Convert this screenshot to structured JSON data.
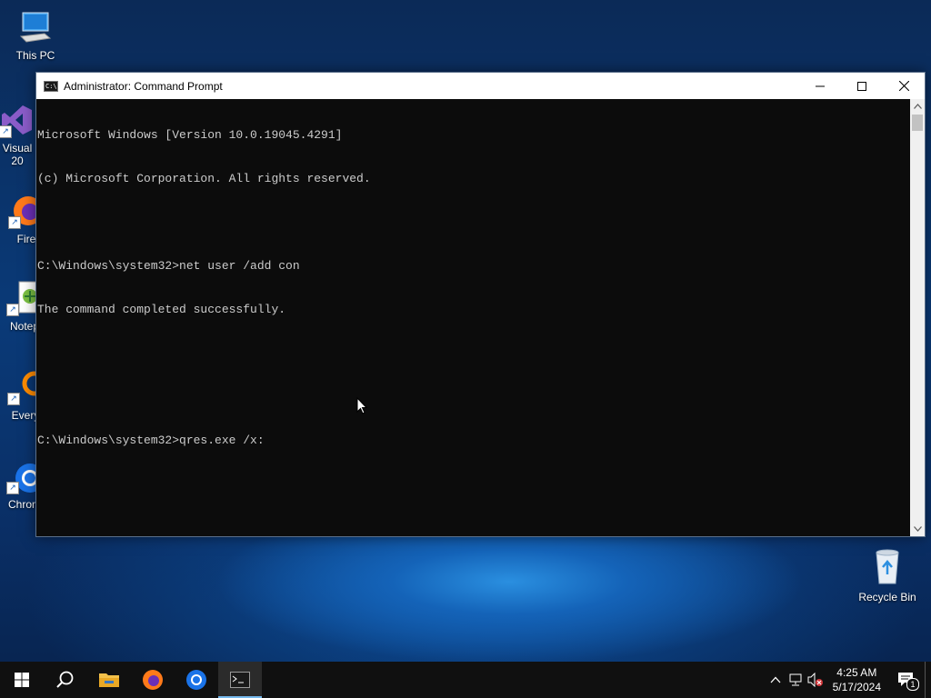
{
  "desktop": {
    "icons": [
      {
        "label": "This PC",
        "icon": "computer-icon"
      },
      {
        "label": "Visual\n20",
        "icon": "visual-studio-icon"
      },
      {
        "label": "Fire",
        "icon": "firefox-icon"
      },
      {
        "label": "Notep",
        "icon": "notepad-icon"
      },
      {
        "label": "Every",
        "icon": "everything-icon"
      },
      {
        "label": "Chrom",
        "icon": "chrome-icon"
      }
    ],
    "recycle_bin": {
      "label": "Recycle Bin",
      "icon": "recycle-bin-icon"
    }
  },
  "window": {
    "title": "Administrator: Command Prompt",
    "console_lines": [
      "Microsoft Windows [Version 10.0.19045.4291]",
      "(c) Microsoft Corporation. All rights reserved.",
      "",
      "C:\\Windows\\system32>net user /add con",
      "The command completed successfully.",
      "",
      "",
      "C:\\Windows\\system32>qres.exe /x:"
    ],
    "controls": {
      "minimize": "minimize-icon",
      "maximize": "maximize-icon",
      "close": "close-icon"
    }
  },
  "taskbar": {
    "buttons": [
      {
        "name": "start",
        "icon": "windows-logo-icon"
      },
      {
        "name": "search",
        "icon": "search-icon"
      },
      {
        "name": "file-explorer",
        "icon": "folder-icon"
      },
      {
        "name": "firefox",
        "icon": "firefox-icon"
      },
      {
        "name": "chrome",
        "icon": "chrome-icon"
      },
      {
        "name": "command-prompt",
        "icon": "cmd-icon",
        "active": true
      }
    ],
    "clock": {
      "time": "4:25 AM",
      "date": "5/17/2024"
    },
    "notifications_count": "1"
  },
  "colors": {
    "console_bg": "#0c0c0c",
    "console_fg": "#cccccc",
    "taskbar_bg": "#101010",
    "accent": "#76b9ed"
  }
}
